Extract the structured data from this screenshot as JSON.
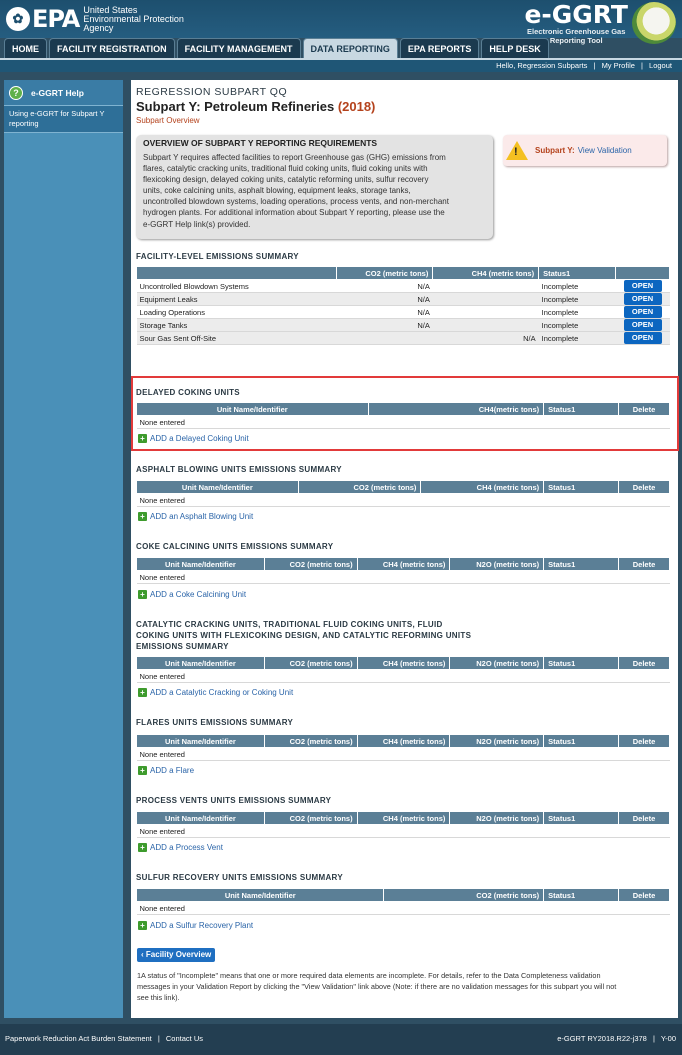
{
  "header": {
    "epa_logo": "EPA",
    "agency_lines": [
      "United States",
      "Environmental Protection",
      "Agency"
    ],
    "app_title": "e-GGRT",
    "app_subtitle_lines": [
      "Electronic Greenhouse Gas",
      "Reporting Tool"
    ]
  },
  "nav": {
    "tabs": [
      {
        "label": "HOME"
      },
      {
        "label": "FACILITY REGISTRATION"
      },
      {
        "label": "FACILITY MANAGEMENT"
      },
      {
        "label": "DATA REPORTING"
      },
      {
        "label": "EPA REPORTS"
      },
      {
        "label": "HELP DESK"
      }
    ],
    "active": "DATA REPORTING"
  },
  "userbar": {
    "greeting": "Hello, Regression Subparts",
    "my_profile": "My Profile",
    "logout": "Logout"
  },
  "sidebar": {
    "help_icon": "question-icon",
    "help_label": "e-GGRT Help",
    "link": "Using e-GGRT for Subpart Y reporting"
  },
  "page": {
    "regression": "REGRESSION SUBPART QQ",
    "title": "Subpart Y: Petroleum Refineries",
    "year": "(2018)",
    "overview_link": "Subpart Overview"
  },
  "overview": {
    "heading": "OVERVIEW OF SUBPART Y REPORTING REQUIREMENTS",
    "lines": [
      "Subpart Y requires affected facilities to report Greenhouse gas (GHG) emissions from",
      "flares, catalytic cracking units, traditional fluid coking units, fluid coking units with",
      "flexicoking design, delayed coking units, catalytic reforming units, sulfur recovery",
      "units, coke calcining units, asphalt blowing, equipment leaks, storage tanks,",
      "uncontrolled blowdown systems, loading operations, process vents, and non-merchant",
      "hydrogen plants. For additional information about Subpart Y reporting, please use the",
      "e-GGRT Help link(s) provided."
    ]
  },
  "validation": {
    "icon": "warning-icon",
    "label": "Subpart Y:",
    "link": "View Validation"
  },
  "facility": {
    "heading": "FACILITY-LEVEL EMISSIONS SUMMARY",
    "columns": [
      "",
      "CO2 (metric tons)",
      "CH4 (metric tons)",
      "Status1",
      ""
    ],
    "rows": [
      {
        "name": "Uncontrolled Blowdown Systems",
        "co2": "N/A",
        "ch4": "",
        "status": "Incomplete",
        "action": "OPEN"
      },
      {
        "name": "Equipment Leaks",
        "co2": "N/A",
        "ch4": "",
        "status": "Incomplete",
        "action": "OPEN"
      },
      {
        "name": "Loading Operations",
        "co2": "N/A",
        "ch4": "",
        "status": "Incomplete",
        "action": "OPEN"
      },
      {
        "name": "Storage Tanks",
        "co2": "N/A",
        "ch4": "",
        "status": "Incomplete",
        "action": "OPEN"
      },
      {
        "name": "Sour Gas Sent Off-Site",
        "co2": "",
        "ch4": "N/A",
        "status": "Incomplete",
        "action": "OPEN"
      }
    ]
  },
  "delayed": {
    "heading": "DELAYED COKING UNITS",
    "columns": [
      "Unit Name/Identifier",
      "CH4(metric tons)",
      "Status1",
      "Delete"
    ],
    "empty": "None entered",
    "add": "ADD a Delayed Coking Unit"
  },
  "asphalt": {
    "heading": "ASPHALT BLOWING UNITS EMISSIONS SUMMARY",
    "columns": [
      "Unit Name/Identifier",
      "CO2 (metric tons)",
      "CH4 (metric tons)",
      "Status1",
      "Delete"
    ],
    "empty": "None entered",
    "add": "ADD an Asphalt Blowing Unit"
  },
  "coke": {
    "heading": "COKE CALCINING UNITS EMISSIONS SUMMARY",
    "columns": [
      "Unit Name/Identifier",
      "CO2 (metric tons)",
      "CH4 (metric tons)",
      "N2O (metric tons)",
      "Status1",
      "Delete"
    ],
    "empty": "None entered",
    "add": "ADD a Coke Calcining Unit"
  },
  "catalytic": {
    "heading_lines": [
      "CATALYTIC CRACKING UNITS, TRADITIONAL FLUID COKING UNITS, FLUID",
      "COKING UNITS WITH FLEXICOKING DESIGN, AND CATALYTIC REFORMING UNITS",
      "EMISSIONS SUMMARY"
    ],
    "columns": [
      "Unit Name/Identifier",
      "CO2 (metric tons)",
      "CH4 (metric tons)",
      "N2O (metric tons)",
      "Status1",
      "Delete"
    ],
    "empty": "None entered",
    "add": "ADD a Catalytic Cracking or Coking Unit"
  },
  "flares": {
    "heading": "FLARES UNITS EMISSIONS SUMMARY",
    "columns": [
      "Unit Name/Identifier",
      "CO2 (metric tons)",
      "CH4 (metric tons)",
      "N2O (metric tons)",
      "Status1",
      "Delete"
    ],
    "empty": "None entered",
    "add": "ADD a Flare"
  },
  "vents": {
    "heading": "PROCESS VENTS UNITS EMISSIONS SUMMARY",
    "columns": [
      "Unit Name/Identifier",
      "CO2 (metric tons)",
      "CH4 (metric tons)",
      "N2O (metric tons)",
      "Status1",
      "Delete"
    ],
    "empty": "None entered",
    "add": "ADD a Process Vent"
  },
  "sulfur": {
    "heading": "SULFUR RECOVERY UNITS EMISSIONS SUMMARY",
    "columns": [
      "Unit Name/Identifier",
      "CO2 (metric tons)",
      "Status1",
      "Delete"
    ],
    "empty": "None entered",
    "add": "ADD a Sulfur Recovery Plant"
  },
  "facility_overview_button": "Facility Overview",
  "footnote_lines": [
    "1A status of \"Incomplete\" means that one or more required data elements are incomplete. For details, refer to the Data Completeness validation",
    "messages in your Validation Report by clicking the \"View Validation\" link above (Note: if there are no validation messages for this subpart you will not",
    "see this link)."
  ],
  "footer": {
    "paperwork": "Paperwork Reduction Act Burden Statement",
    "contact": "Contact Us",
    "version": "e-GGRT RY2018.R22-j378",
    "server": "Y-00"
  }
}
